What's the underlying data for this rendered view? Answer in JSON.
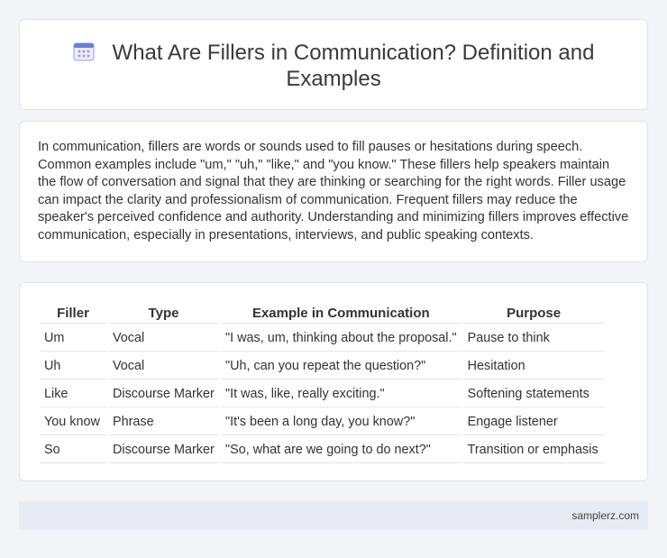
{
  "header": {
    "icon": "calendar-icon",
    "title": "What Are Fillers in Communication? Definition and Examples"
  },
  "intro": {
    "text": "In communication, fillers are words or sounds used to fill pauses or hesitations during speech. Common examples include \"um,\" \"uh,\" \"like,\" and \"you know.\" These fillers help speakers maintain the flow of conversation and signal that they are thinking or searching for the right words. Filler usage can impact the clarity and professionalism of communication. Frequent fillers may reduce the speaker's perceived confidence and authority. Understanding and minimizing fillers improves effective communication, especially in presentations, interviews, and public speaking contexts."
  },
  "table": {
    "headers": [
      "Filler",
      "Type",
      "Example in Communication",
      "Purpose"
    ],
    "rows": [
      [
        "Um",
        "Vocal",
        "\"I was, um, thinking about the proposal.\"",
        "Pause to think"
      ],
      [
        "Uh",
        "Vocal",
        "\"Uh, can you repeat the question?\"",
        "Hesitation"
      ],
      [
        "Like",
        "Discourse Marker",
        "\"It was, like, really exciting.\"",
        "Softening statements"
      ],
      [
        "You know",
        "Phrase",
        "\"It's been a long day, you know?\"",
        "Engage listener"
      ],
      [
        "So",
        "Discourse Marker",
        "\"So, what are we going to do next?\"",
        "Transition or emphasis"
      ]
    ]
  },
  "footer": {
    "site": "samplerz.com"
  },
  "colors": {
    "background": "#f2f4f8",
    "card": "#ffffff",
    "footer_bg": "#e6ebf4",
    "icon_accent": "#6b7fd8"
  }
}
